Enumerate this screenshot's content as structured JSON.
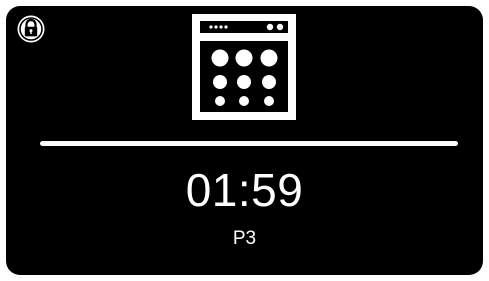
{
  "display": {
    "time": "01:59",
    "program": "P3"
  },
  "icons": {
    "lock": "padlock-icon",
    "appliance": "dishwasher-icon"
  },
  "colors": {
    "background": "#000000",
    "foreground": "#ffffff"
  }
}
